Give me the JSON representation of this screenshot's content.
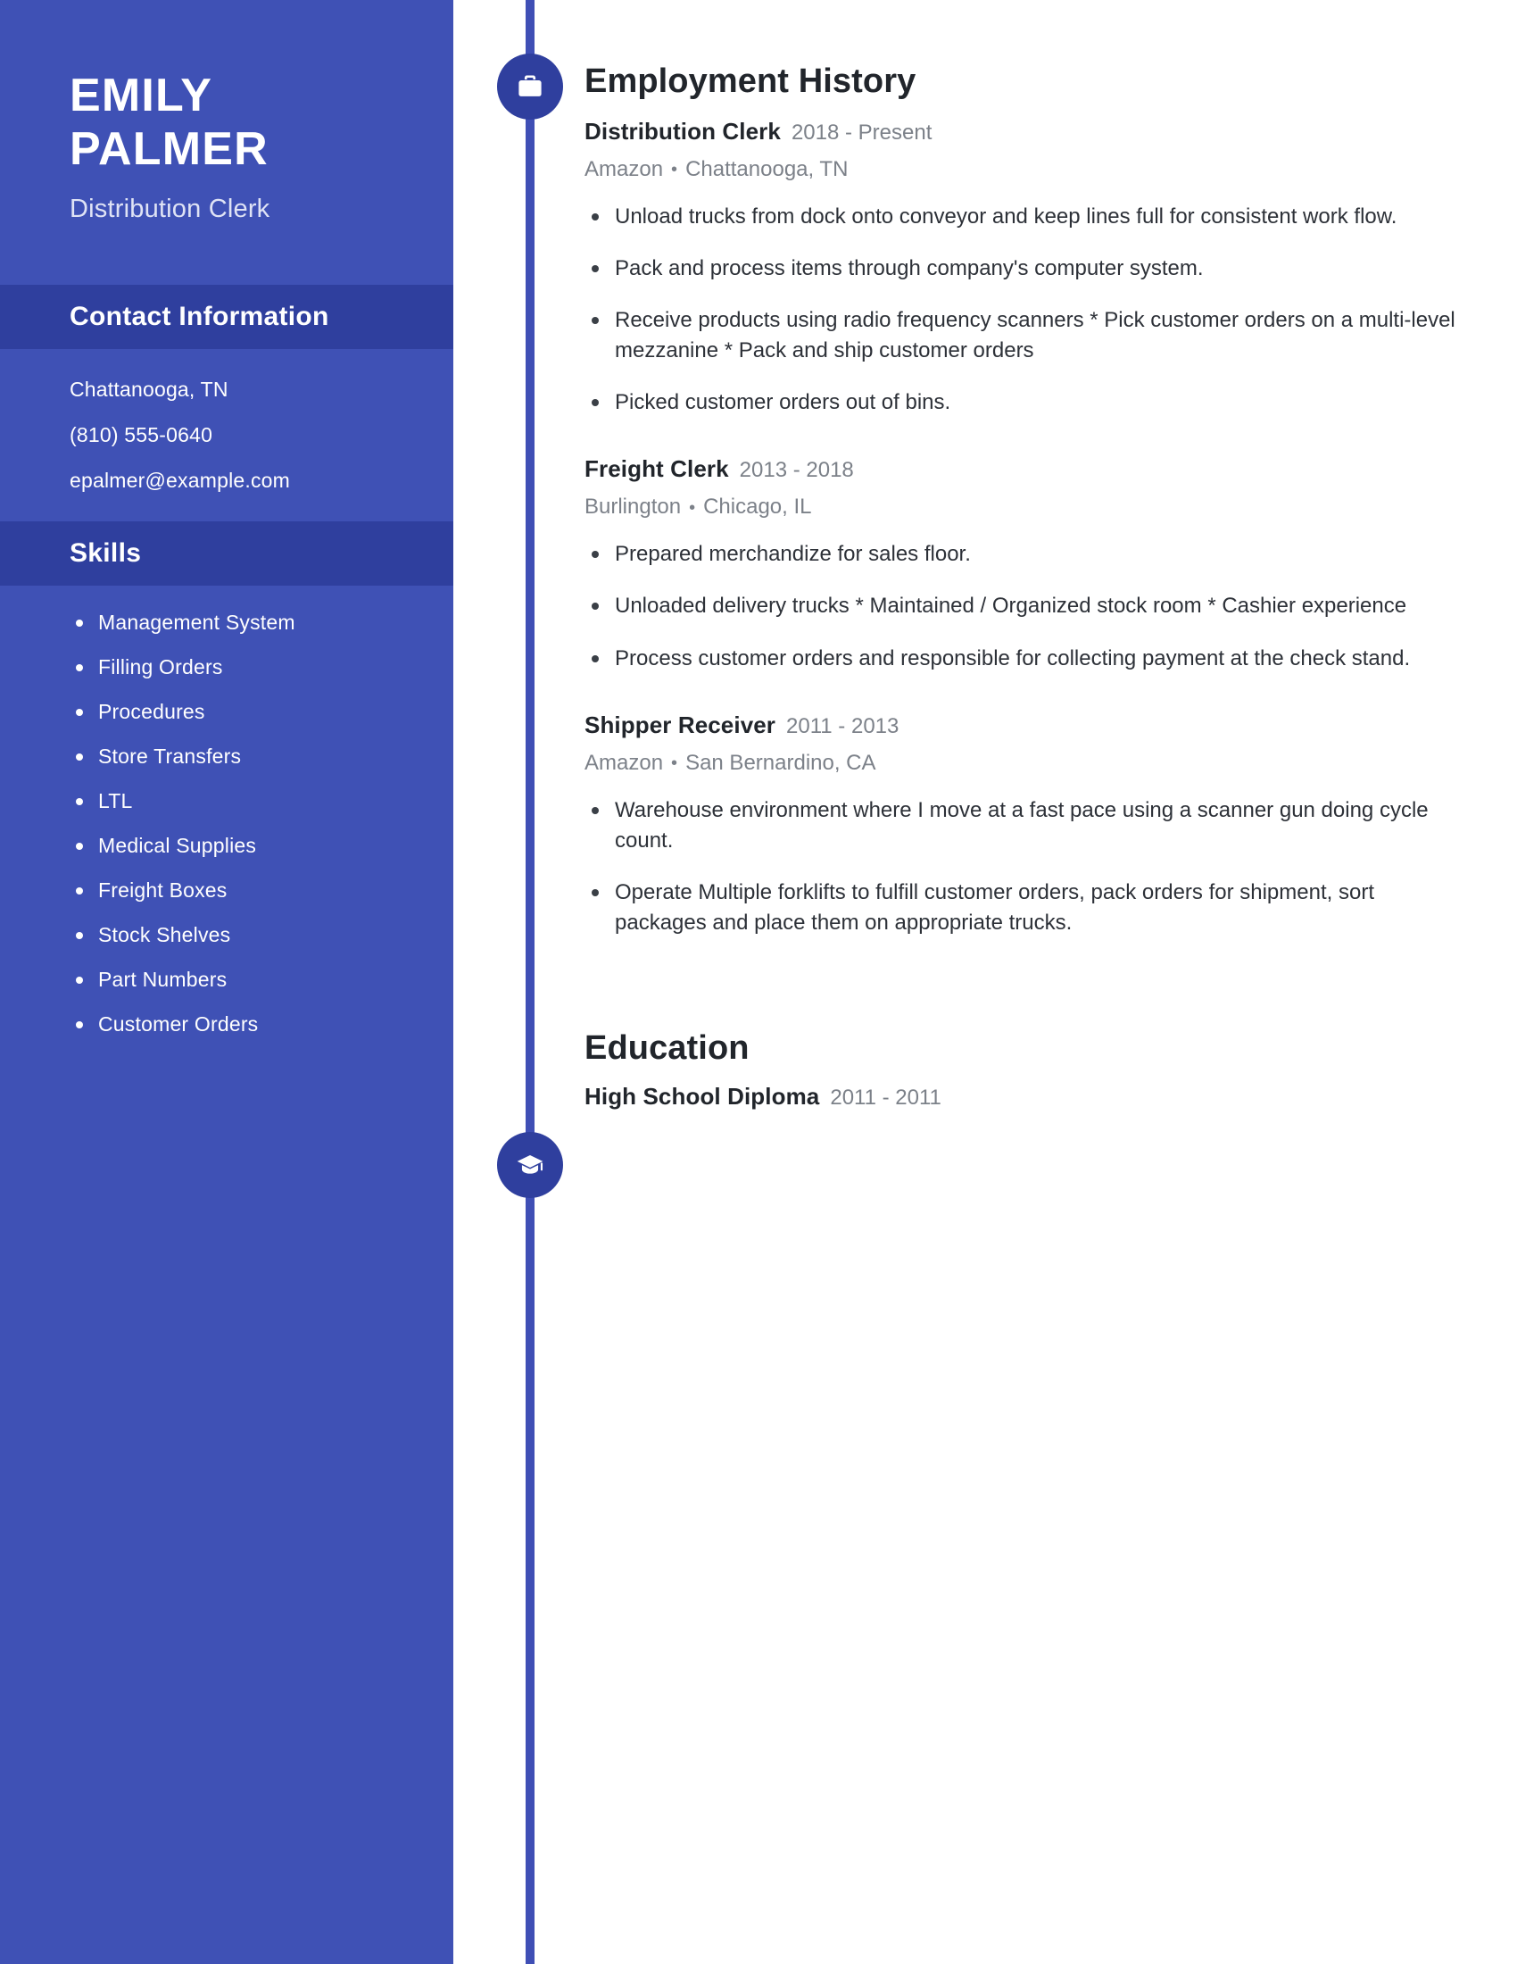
{
  "colors": {
    "sidebar_bg": "#3f51b5",
    "sidebar_band_bg": "#2f3f9e",
    "accent": "#2f3f9e",
    "timeline": "#3f4fb5",
    "heading_text": "#21252b",
    "muted_text": "#7c8189",
    "body_text": "#2d3138"
  },
  "sidebar": {
    "first_name": "EMILY",
    "last_name": "PALMER",
    "job_title": "Distribution Clerk",
    "contact": {
      "heading": "Contact Information",
      "lines": [
        "Chattanooga, TN",
        "(810) 555-0640",
        "epalmer@example.com"
      ]
    },
    "skills": {
      "heading": "Skills",
      "items": [
        "Management System",
        "Filling Orders",
        "Procedures",
        "Store Transfers",
        "LTL",
        "Medical Supplies",
        "Freight Boxes",
        "Stock Shelves",
        "Part Numbers",
        "Customer Orders"
      ]
    }
  },
  "main": {
    "employment": {
      "heading": "Employment History",
      "icon": "briefcase-icon",
      "entries": [
        {
          "role": "Distribution Clerk",
          "dates": "2018 - Present",
          "company": "Amazon",
          "location": "Chattanooga, TN",
          "bullets": [
            "Unload trucks from dock onto conveyor and keep lines full for consistent work flow.",
            "Pack and process items through company's computer system.",
            "Receive products using radio frequency scanners * Pick customer orders on a multi-level mezzanine * Pack and ship customer orders",
            "Picked customer orders out of bins."
          ]
        },
        {
          "role": "Freight Clerk",
          "dates": "2013 - 2018",
          "company": "Burlington",
          "location": "Chicago, IL",
          "bullets": [
            "Prepared merchandize for sales floor.",
            "Unloaded delivery trucks * Maintained / Organized stock room * Cashier experience",
            "Process customer orders and responsible for collecting payment at the check stand."
          ]
        },
        {
          "role": "Shipper Receiver",
          "dates": "2011 - 2013",
          "company": "Amazon",
          "location": "San Bernardino, CA",
          "bullets": [
            "Warehouse environment where I move at a fast pace using a scanner gun doing cycle count.",
            "Operate Multiple forklifts to fulfill customer orders, pack orders for shipment, sort packages and place them on appropriate trucks."
          ]
        }
      ]
    },
    "education": {
      "heading": "Education",
      "icon": "graduation-cap-icon",
      "entries": [
        {
          "degree": "High School Diploma",
          "dates": "2011 - 2011"
        }
      ]
    },
    "separator_dot": "•"
  }
}
